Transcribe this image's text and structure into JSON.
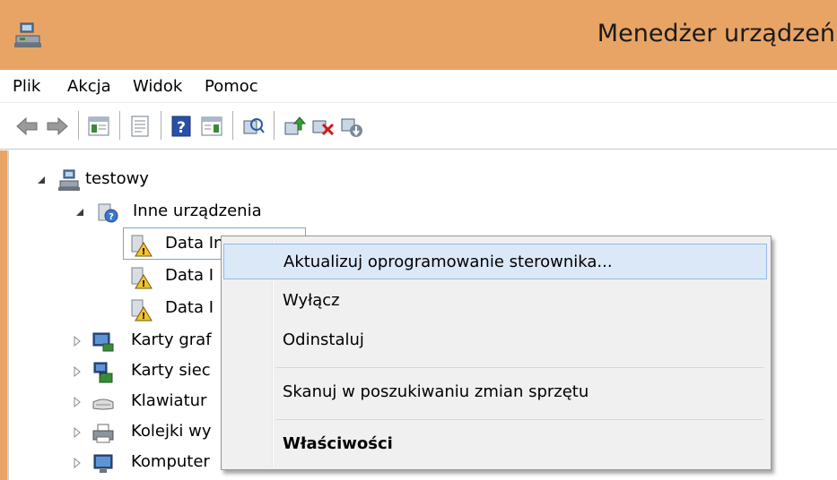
{
  "window": {
    "title": "Menedżer urządzeń",
    "title_bar_color": "#e8a465"
  },
  "menubar": {
    "items": [
      "Plik",
      "Akcja",
      "Widok",
      "Pomoc"
    ]
  },
  "toolbar": {
    "buttons": [
      "back-icon",
      "forward-icon",
      "show-hide-console-tree-icon",
      "properties-icon",
      "help-icon",
      "show-action-pane-icon",
      "scan-hardware-icon",
      "update-driver-icon",
      "disable-device-icon",
      "uninstall-device-icon"
    ]
  },
  "tree": {
    "root": "testowy",
    "other_devices": "Inne urządzenia",
    "children": [
      {
        "label": "Data Interf"
      },
      {
        "label": "Data I"
      },
      {
        "label": "Data I"
      }
    ],
    "categories": [
      {
        "label": "Karty graf"
      },
      {
        "label": "Karty siec"
      },
      {
        "label": "Klawiatur"
      },
      {
        "label": "Kolejki wy"
      },
      {
        "label": "Komputer"
      }
    ]
  },
  "context_menu": {
    "items": [
      {
        "label": "Aktualizuj oprogramowanie sterownika...",
        "highlighted": true
      },
      {
        "label": "Wyłącz"
      },
      {
        "label": "Odinstaluj"
      },
      {
        "label": "Skanuj w poszukiwaniu zmian sprzętu"
      },
      {
        "label": "Właściwości",
        "bold": true
      }
    ],
    "highlight_color": "#dbe8f8"
  }
}
